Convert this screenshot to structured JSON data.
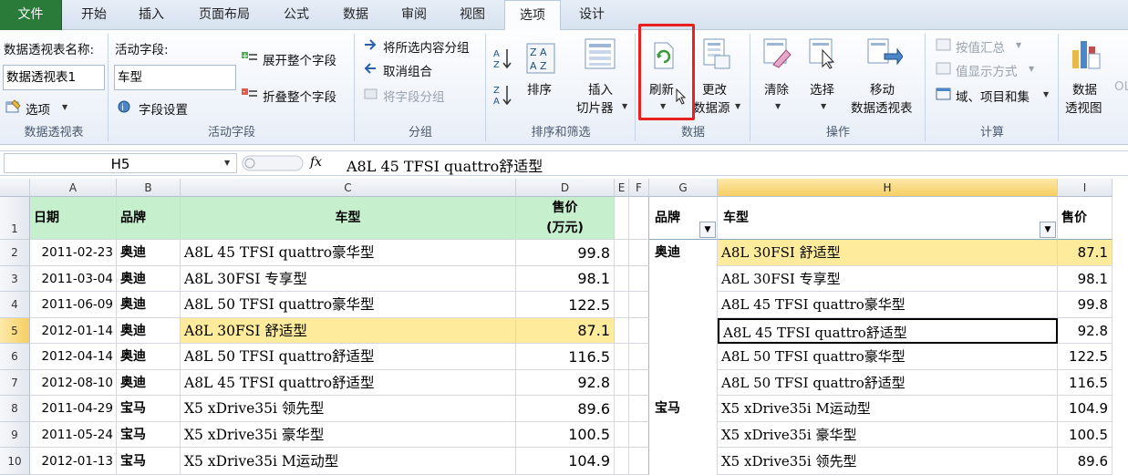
{
  "tabs": [
    "文件",
    "开始",
    "插入",
    "页面布局",
    "公式",
    "数据",
    "审阅",
    "视图",
    "选项",
    "设计"
  ],
  "ribbon": {
    "pivot_name_label": "数据透视表名称:",
    "pivot_name_value": "数据透视表1",
    "options_button": "选项",
    "group_pivot": "数据透视表",
    "active_field_label": "活动字段:",
    "active_field_value": "车型",
    "field_settings": "字段设置",
    "expand_field": "展开整个字段",
    "collapse_field": "折叠整个字段",
    "group_active_field": "活动字段",
    "group_selection": "将所选内容分组",
    "ungroup": "取消组合",
    "group_field": "将字段分组",
    "group_grouping": "分组",
    "sort_label": "排序",
    "insert_slicer_1": "插入",
    "insert_slicer_2": "切片器",
    "group_sort_filter": "排序和筛选",
    "refresh": "刷新",
    "change_source_1": "更改",
    "change_source_2": "数据源",
    "group_data": "数据",
    "clear": "清除",
    "select": "选择",
    "move_1": "移动",
    "move_2": "数据透视表",
    "group_actions": "操作",
    "summarize_by": "按值汇总",
    "show_values_as": "值显示方式",
    "fields_items_sets": "域、项目和集",
    "group_calc": "计算",
    "pivot_chart_1": "数据",
    "pivot_chart_2": "透视图",
    "cutoff": "OL"
  },
  "formula_bar": {
    "name_box": "H5",
    "fx": "fx",
    "value": "A8L 45 TFSI quattro舒适型"
  },
  "columns": [
    "A",
    "B",
    "C",
    "D",
    "E",
    "F",
    "G",
    "H",
    "I"
  ],
  "rows": [
    "1",
    "2",
    "3",
    "4",
    "5",
    "6",
    "7",
    "8",
    "9",
    "10"
  ],
  "source_table": {
    "headers": {
      "date": "日期",
      "brand": "品牌",
      "model": "车型",
      "price_1": "售价",
      "price_2": "(万元)"
    },
    "rows": [
      {
        "date": "2011-02-23",
        "brand": "奥迪",
        "model": "A8L 45 TFSI quattro豪华型",
        "price": "99.8"
      },
      {
        "date": "2011-03-04",
        "brand": "奥迪",
        "model": "A8L 30FSI 专享型",
        "price": "98.1"
      },
      {
        "date": "2011-06-09",
        "brand": "奥迪",
        "model": "A8L 50 TFSI quattro豪华型",
        "price": "122.5"
      },
      {
        "date": "2012-01-14",
        "brand": "奥迪",
        "model": "A8L 30FSI 舒适型",
        "price": "87.1"
      },
      {
        "date": "2012-04-14",
        "brand": "奥迪",
        "model": "A8L 50 TFSI quattro舒适型",
        "price": "116.5"
      },
      {
        "date": "2012-08-10",
        "brand": "奥迪",
        "model": "A8L 45 TFSI quattro舒适型",
        "price": "92.8"
      },
      {
        "date": "2011-04-29",
        "brand": "宝马",
        "model": "X5 xDrive35i 领先型",
        "price": "89.6"
      },
      {
        "date": "2011-05-24",
        "brand": "宝马",
        "model": "X5 xDrive35i 豪华型",
        "price": "100.5"
      },
      {
        "date": "2012-01-13",
        "brand": "宝马",
        "model": "X5 xDrive35i M运动型",
        "price": "104.9"
      }
    ]
  },
  "pivot_table": {
    "headers": {
      "brand": "品牌",
      "model": "车型",
      "price": "售价"
    },
    "rows": [
      {
        "brand": "奥迪",
        "model": "A8L 30FSI 舒适型",
        "price": "87.1"
      },
      {
        "brand": "",
        "model": "A8L 30FSI 专享型",
        "price": "98.1"
      },
      {
        "brand": "",
        "model": "A8L 45 TFSI quattro豪华型",
        "price": "99.8"
      },
      {
        "brand": "",
        "model": "A8L 45 TFSI quattro舒适型",
        "price": "92.8"
      },
      {
        "brand": "",
        "model": "A8L 50 TFSI quattro豪华型",
        "price": "122.5"
      },
      {
        "brand": "",
        "model": "A8L 50 TFSI quattro舒适型",
        "price": "116.5"
      },
      {
        "brand": "宝马",
        "model": "X5 xDrive35i M运动型",
        "price": "104.9"
      },
      {
        "brand": "",
        "model": "X5 xDrive35i 豪华型",
        "price": "100.5"
      },
      {
        "brand": "",
        "model": "X5 xDrive35i 领先型",
        "price": "89.6"
      }
    ]
  },
  "colors": {
    "file_tab": "#2a7a3a",
    "header_green": "#c6efce",
    "highlight_yellow": "#ffeb9c",
    "refresh_callout": "#e82020"
  }
}
